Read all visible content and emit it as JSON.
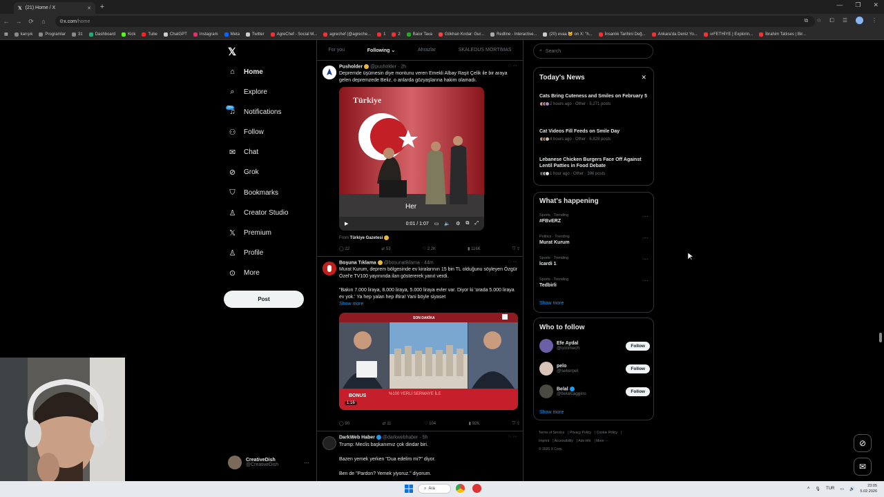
{
  "browser": {
    "tab_title": "(21) Home / X",
    "url_host": "x.com",
    "url_path": "/home",
    "bookmarks": [
      "karışık",
      "Programlar",
      "31",
      "Dashboard",
      "Kick",
      "Tube",
      "ChatGPT",
      "Instagram",
      "Meta",
      "Twitter",
      "AgreChef - Social M...",
      "agrechef (@agreche...",
      "1",
      "2",
      "Baior Tava",
      "Gökhan Kırdar: Gur...",
      "Redline - Interactive...",
      "(20) evaa 🐱 on X: \"h...",
      "İnsanlık Tarihini Değ...",
      "Ankara'da Deniz Yo...",
      "ıırFETHİYE | Explorin...",
      "İbrahim Tatlıses | Bir..."
    ]
  },
  "nav": {
    "items": [
      {
        "label": "Home",
        "icon": "home-icon"
      },
      {
        "label": "Explore",
        "icon": "search-icon"
      },
      {
        "label": "Notifications",
        "icon": "bell-icon"
      },
      {
        "label": "Follow",
        "icon": "person-plus-icon"
      },
      {
        "label": "Chat",
        "icon": "mail-icon"
      },
      {
        "label": "Grok",
        "icon": "grok-icon"
      },
      {
        "label": "Bookmarks",
        "icon": "bookmark-icon"
      },
      {
        "label": "Creator Studio",
        "icon": "creator-icon"
      },
      {
        "label": "Premium",
        "icon": "x-icon"
      },
      {
        "label": "Profile",
        "icon": "person-icon"
      },
      {
        "label": "More",
        "icon": "more-circle-icon"
      }
    ],
    "notif_badge": "20+",
    "post_label": "Post",
    "user_name": "CreativeDish",
    "user_handle": "@CreativeDish"
  },
  "timeline": {
    "tabs": [
      "For you",
      "Following",
      "Ahrazlar",
      "SKALEDUS MORTIMAS"
    ],
    "tweets": [
      {
        "name": "Pusholder",
        "handle": "@pusholder · 2h",
        "text": "Depremde üşümesin diye montunu veren Emekli Albay Raşit Çelik ile bir araya gelen depremzede Beliz, o anlarda gözyaşlarına hakim olamadı.",
        "video_brand": "Türkiye",
        "video_caption": "Her",
        "video_time": "0:01 / 1:07",
        "from_label": "From",
        "from_source": "Türkiye Gazetesi",
        "replies": "22",
        "reposts": "53",
        "likes": "2,2K",
        "views": "116K"
      },
      {
        "name": "Boşuna Tıklama",
        "handle": "@bosunatiklama · 44m",
        "text": "Murat Kurum, deprem bölgesinde ev kiralarının 15 bin TL olduğunu söyleyen Özgür Özel'e TV100 yayınında ilan göstererek yanıt verdi.",
        "quote": "\"Bakın 7.000 liraya, 8.000 liraya, 5.000 liraya evler var. Diyor ki 'orada 5.000 liraya ev yok.' Ya hep yalan hep iftira! Yani böyle siyaset",
        "show_more": "Show more",
        "media_banner": "SON DAKİKA",
        "media_bonus": "BONUS",
        "media_strip": "%100 YERLİ SERMAYE İLE",
        "media_duration": "1:16",
        "replies": "90",
        "reposts": "11",
        "likes": "104",
        "views": "92K"
      },
      {
        "name": "DarkWeb Haber",
        "handle": "@darkwebhaber · 5h",
        "line1": "Trump: Meclis başkanımız çok dindar biri.",
        "line2": "Bazen yemek yerken \"Dua edelim mi?\" diyor.",
        "line3": "Ben de \"Pardon? Yemek yiyoruz.\" diyorum."
      }
    ]
  },
  "sidebar": {
    "search_placeholder": "Search",
    "today_news": {
      "title": "Today's News",
      "items": [
        {
          "title": "Cats Bring Cuteness and Smiles on February 5",
          "meta": "2 hours ago · Other · 5,271 posts"
        },
        {
          "title": "Cat Videos Fill Feeds on Smile Day",
          "meta": "4 hours ago · Other · 6,828 posts"
        },
        {
          "title": "Lebanese Chicken Burgers Face Off Against Lentil Patties in Food Debate",
          "meta": "1 hour ago · Other · 396 posts"
        }
      ]
    },
    "happening": {
      "title": "What's happening",
      "items": [
        {
          "context": "Sports · Trending",
          "name": "#FBvERZ"
        },
        {
          "context": "Politics · Trending",
          "name": "Murat Kurum"
        },
        {
          "context": "Sports · Trending",
          "name": "İcardi 1"
        },
        {
          "context": "Sports · Trending",
          "name": "Tedbirli"
        }
      ],
      "show_more": "Show more"
    },
    "who_to_follow": {
      "title": "Who to follow",
      "users": [
        {
          "name": "Efe Aydal",
          "handle": "@conmech"
        },
        {
          "name": "pelo",
          "handle": "@sekerpel"
        },
        {
          "name": "Belal",
          "handle": "@belalcaggins"
        }
      ],
      "follow_label": "Follow",
      "show_more": "Show more"
    },
    "footer": [
      "Terms of Service",
      "Privacy Policy",
      "Cookie Policy",
      "Imprint",
      "Accessibility",
      "Ads info",
      "More ···",
      "© 2026 X Corp."
    ]
  },
  "taskbar": {
    "search": "Ara",
    "lang": "TUR",
    "time": "23:05",
    "date": "5.02.2026"
  },
  "colors": {
    "accent": "#1d9bf0",
    "background": "#000000",
    "flag_red": "#d8232a"
  }
}
